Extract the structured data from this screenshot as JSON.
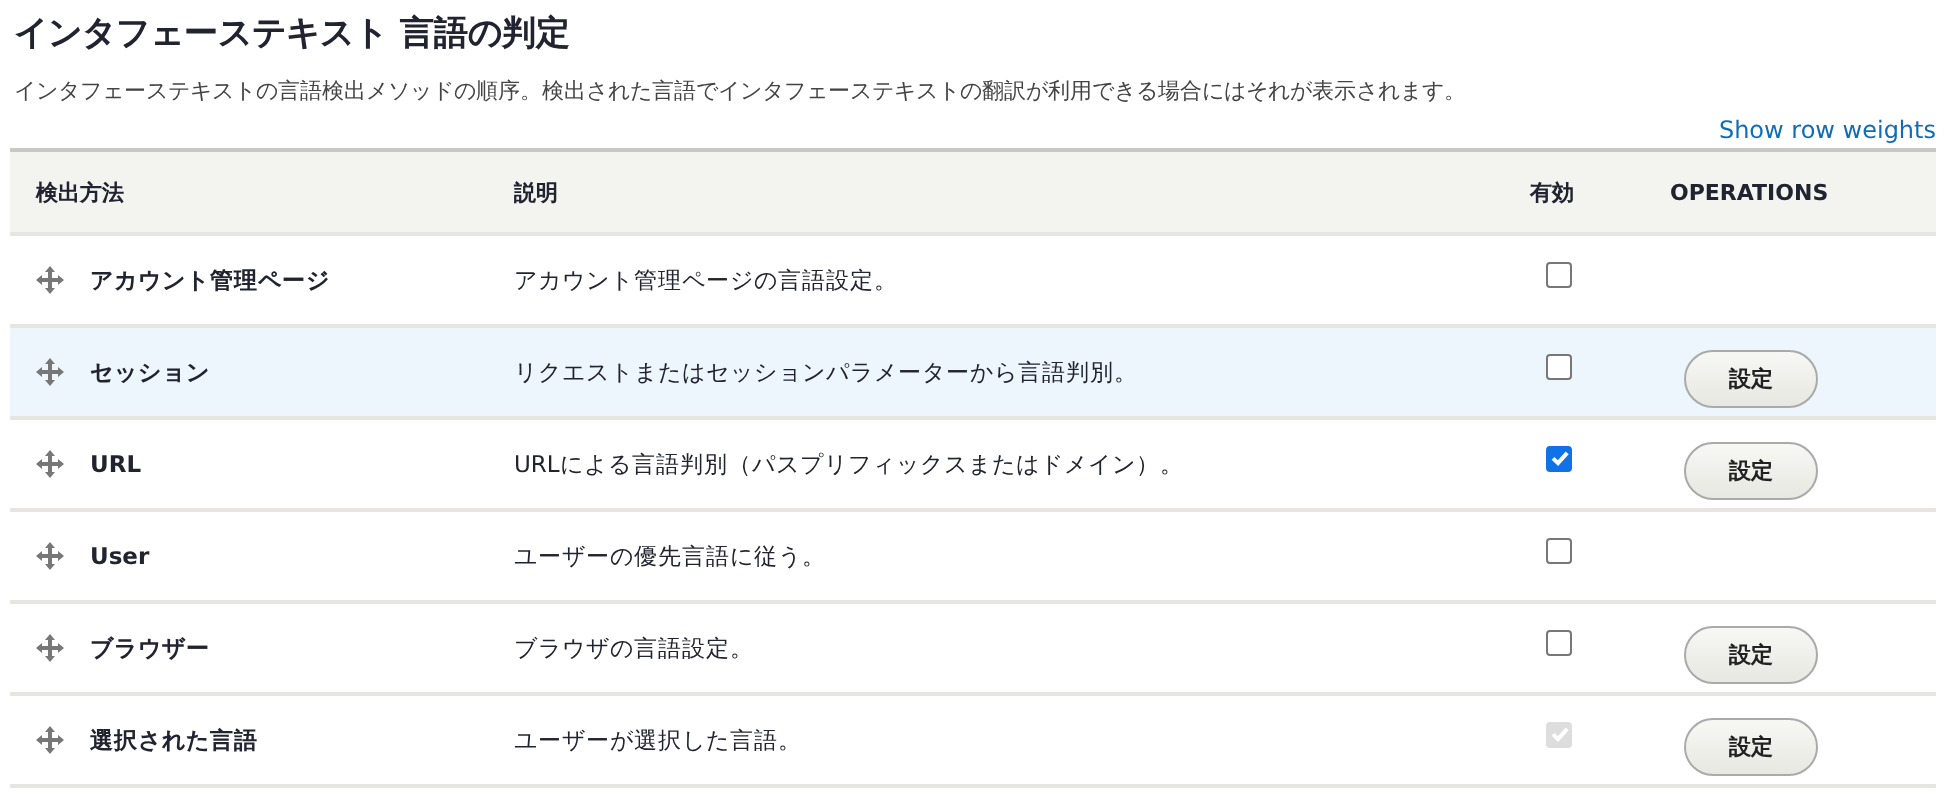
{
  "title": "インタフェーステキスト 言語の判定",
  "description": "インタフェーステキストの言語検出メソッドの順序。検出された言語でインタフェーステキストの翻訳が利用できる場合にはそれが表示されます。",
  "weights_link": "Show row weights",
  "table": {
    "columns": [
      "検出方法",
      "説明",
      "有効",
      "OPERATIONS"
    ],
    "rows": [
      {
        "name": "アカウント管理ページ",
        "description": "アカウント管理ページの言語設定。",
        "checked": false,
        "disabled": false,
        "highlighted": false
      },
      {
        "name": "セッション",
        "description": "リクエストまたはセッションパラメーターから言語判別。",
        "checked": false,
        "disabled": false,
        "highlighted": true,
        "operation": "設定"
      },
      {
        "name": "URL",
        "description": "URLによる言語判別（パスプリフィックスまたはドメイン）。",
        "checked": true,
        "disabled": false,
        "highlighted": false,
        "operation": "設定"
      },
      {
        "name": "User",
        "description": "ユーザーの優先言語に従う。",
        "checked": false,
        "disabled": false,
        "highlighted": false
      },
      {
        "name": "ブラウザー",
        "description": "ブラウザの言語設定。",
        "checked": false,
        "disabled": false,
        "highlighted": false,
        "operation": "設定"
      },
      {
        "name": "選択された言語",
        "description": "ユーザーが選択した言語。",
        "checked": true,
        "disabled": true,
        "highlighted": false,
        "operation": "設定"
      }
    ]
  }
}
